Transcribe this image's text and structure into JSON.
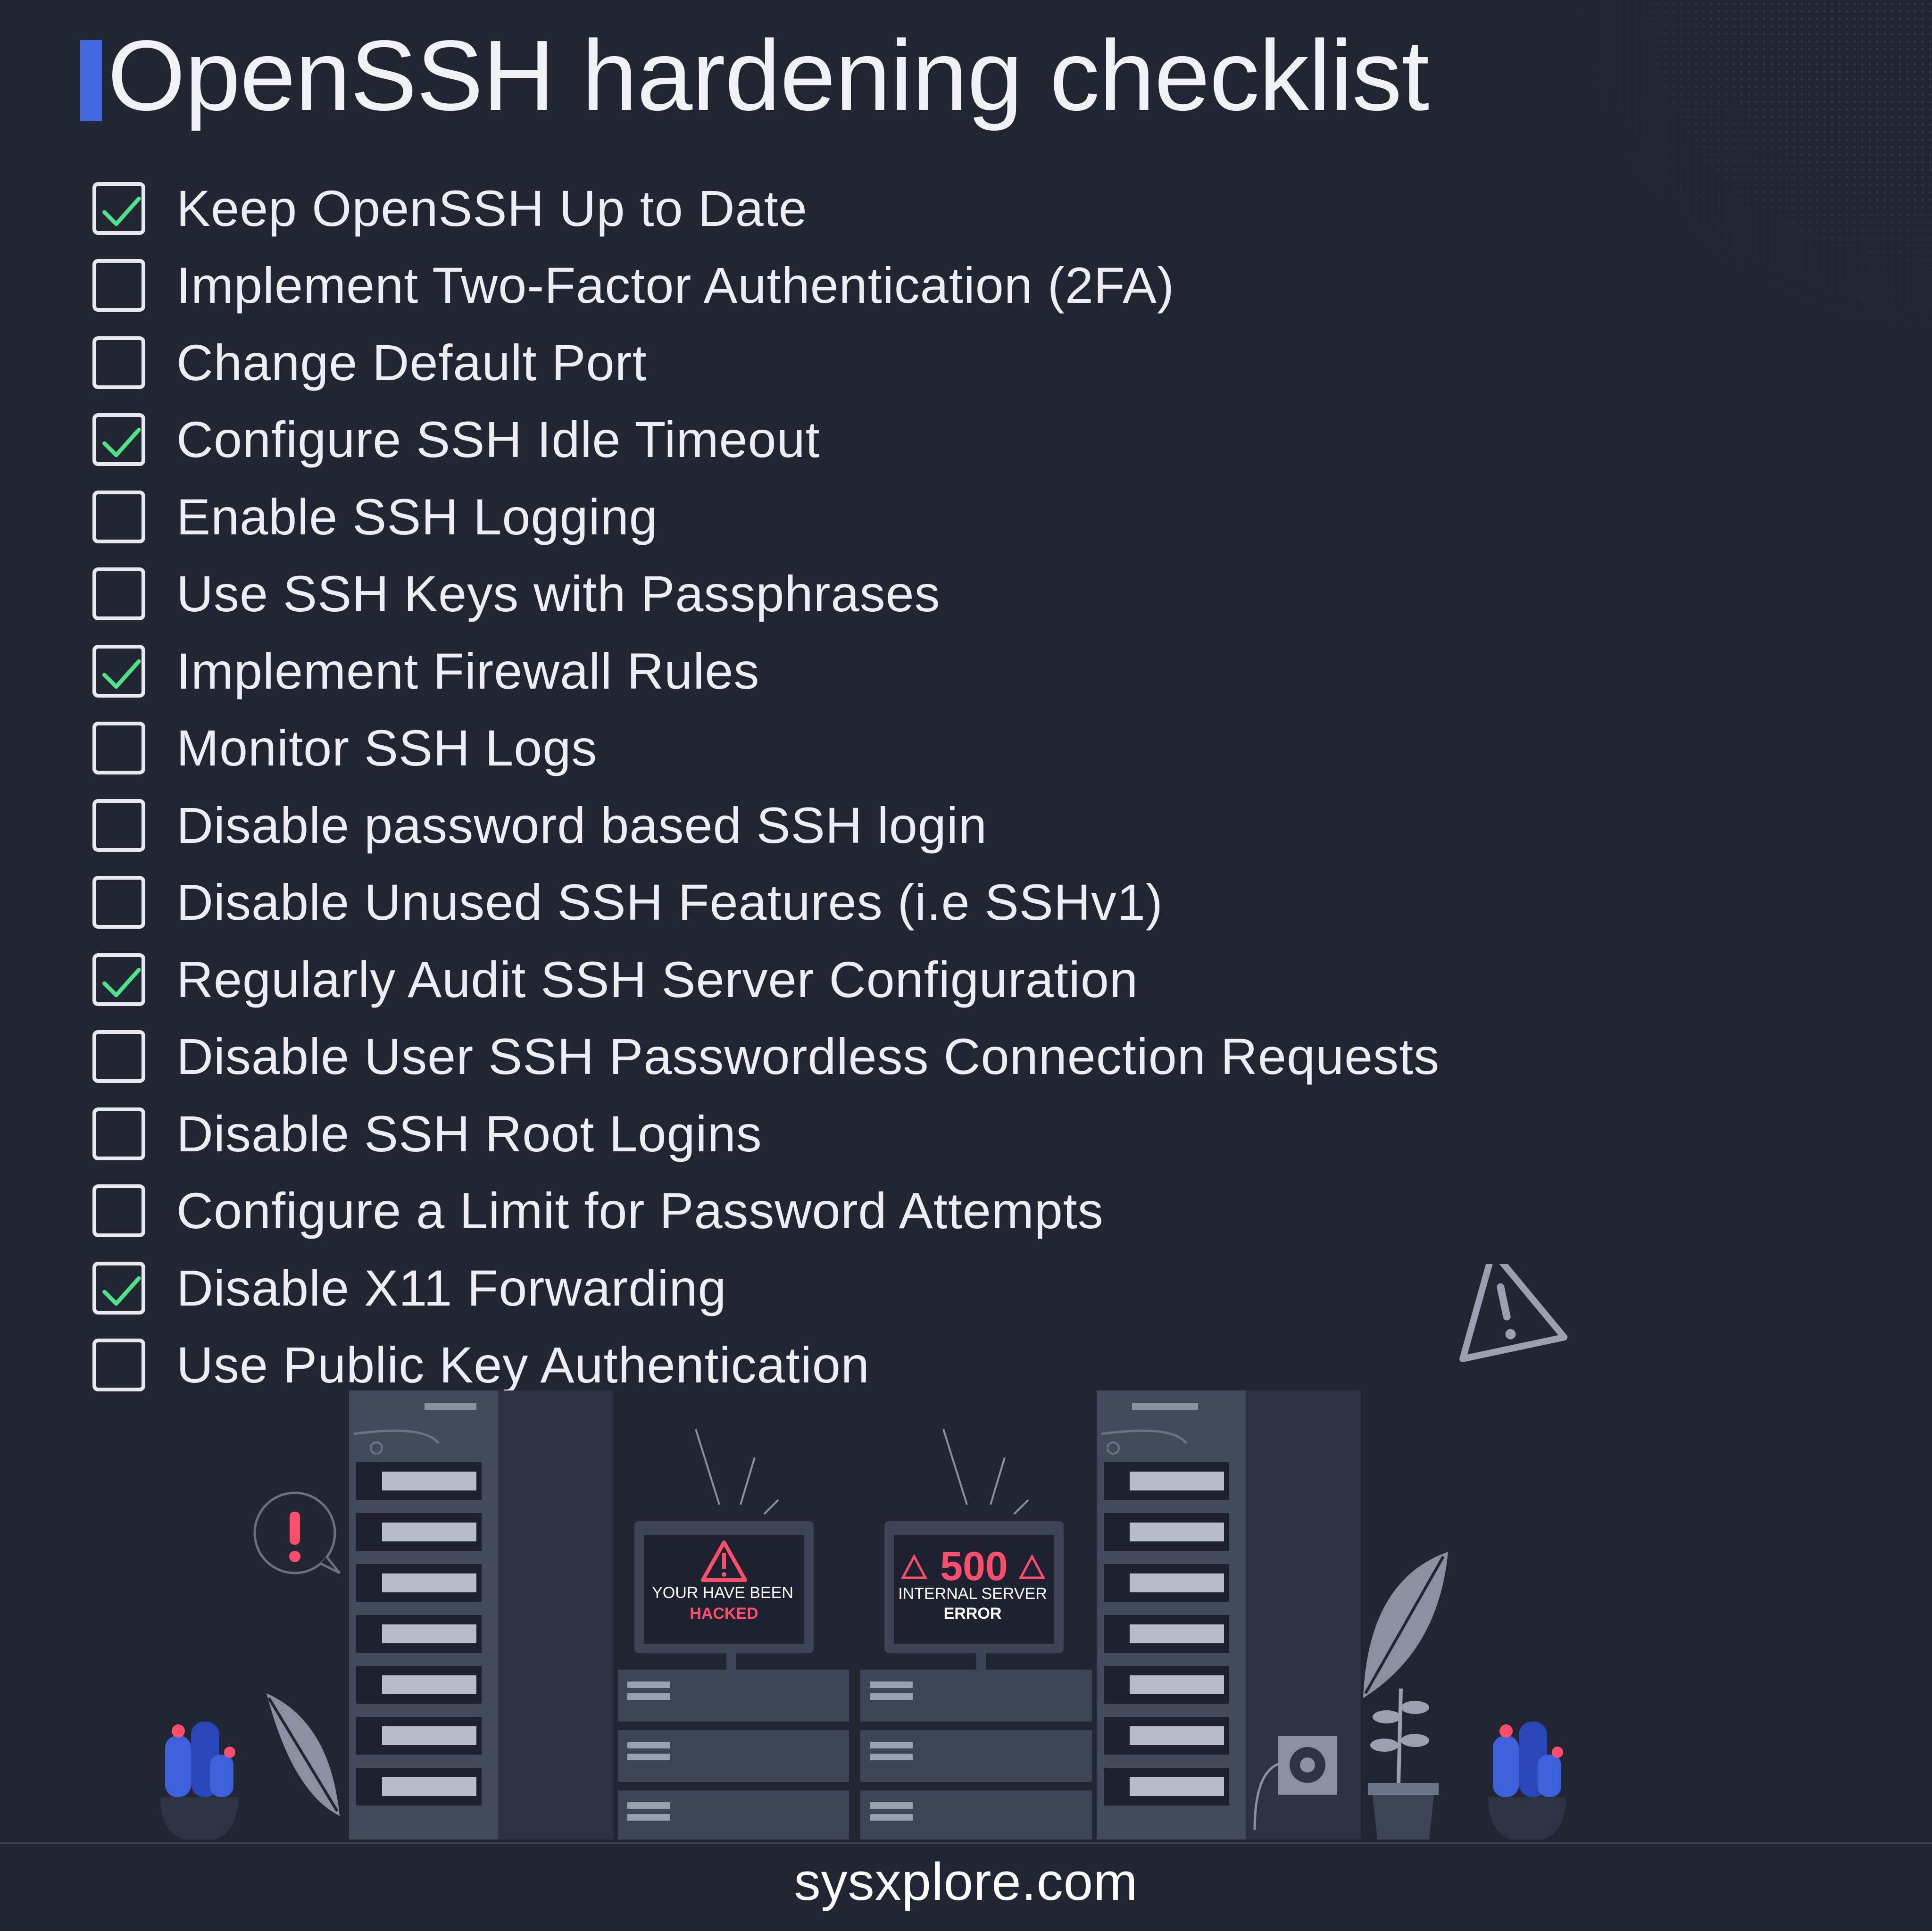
{
  "page": {
    "title": "OpenSSH hardening checklist",
    "footer": "sysxplore.com",
    "accent_color": "#4169e1",
    "check_color": "#4ee28a",
    "alert_color": "#ff4d6d"
  },
  "checklist": [
    {
      "label": "Keep OpenSSH Up to Date",
      "checked": true
    },
    {
      "label": "Implement Two-Factor Authentication (2FA)",
      "checked": false
    },
    {
      "label": "Change Default Port",
      "checked": false
    },
    {
      "label": "Configure SSH Idle Timeout",
      "checked": true
    },
    {
      "label": "Enable SSH Logging",
      "checked": false
    },
    {
      "label": "Use SSH Keys with Passphrases",
      "checked": false
    },
    {
      "label": "Implement Firewall Rules",
      "checked": true
    },
    {
      "label": "Monitor SSH Logs",
      "checked": false
    },
    {
      "label": "Disable password based SSH login",
      "checked": false
    },
    {
      "label": "Disable Unused SSH Features (i.e SSHv1)",
      "checked": false
    },
    {
      "label": "Regularly Audit SSH Server Configuration",
      "checked": true
    },
    {
      "label": "Disable User SSH Passwordless Connection Requests",
      "checked": false
    },
    {
      "label": "Disable SSH Root Logins",
      "checked": false
    },
    {
      "label": "Configure a Limit for Password Attempts",
      "checked": false
    },
    {
      "label": "Disable X11 Forwarding",
      "checked": true
    },
    {
      "label": "Use Public Key Authentication",
      "checked": false
    }
  ],
  "illustration": {
    "monitor_left": {
      "line1": "YOUR HAVE BEEN",
      "line2": "HACKED"
    },
    "monitor_right": {
      "code": "500",
      "line1": "INTERNAL SERVER",
      "line2": "ERROR"
    },
    "icons": [
      "warning-triangle-icon",
      "exclamation-bubble-icon",
      "server-rack-icon",
      "plant-icon",
      "cactus-icon",
      "fan-icon"
    ]
  }
}
